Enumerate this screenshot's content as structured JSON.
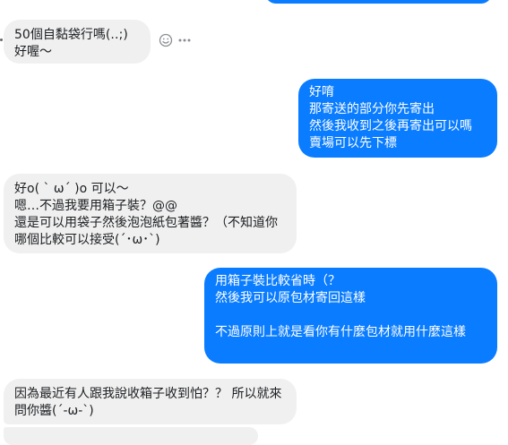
{
  "messages": [
    {
      "id": "m1",
      "sender": "them",
      "text": "50個自黏袋行嗎(‥;)\n好喔～"
    },
    {
      "id": "m2",
      "sender": "me",
      "text": "好唷\n那寄送的部分你先寄出\n然後我收到之後再寄出可以嗎\n賣場可以先下標"
    },
    {
      "id": "m3",
      "sender": "them",
      "text": "好o( ` ω´ )o 可以～\n嗯…不過我要用箱子裝？@@\n還是可以用袋子然後泡泡紙包著醬？（不知道你哪個比較可以接受(´･ω･`)"
    },
    {
      "id": "m4",
      "sender": "me",
      "text": "用箱子裝比較省時（？\n然後我可以原包材寄回這樣\n\n不過原則上就是看你有什麼包材就用什麼這樣"
    },
    {
      "id": "m5",
      "sender": "them",
      "text": "因為最近有人跟我說收箱子收到怕？？ 所以就來問你醬(´-ω-`)"
    }
  ],
  "colors": {
    "incoming_bg": "#f0f0f0",
    "outgoing_bg": "#0a7cff"
  },
  "icons": {
    "react": "smiley-icon",
    "more": "more-options-icon"
  }
}
